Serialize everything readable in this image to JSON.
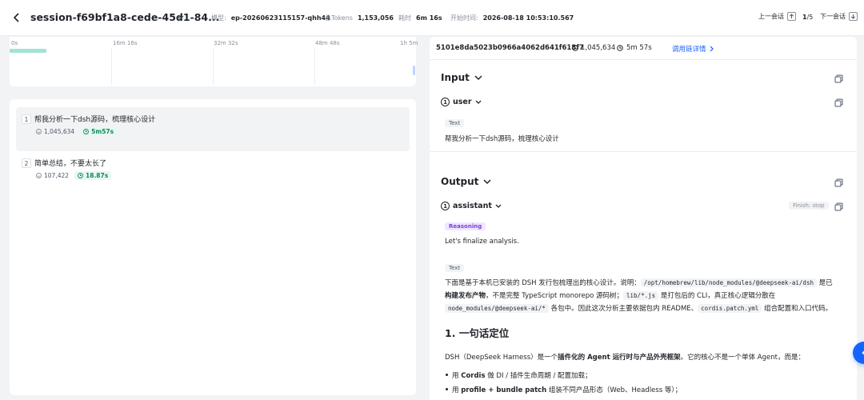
{
  "header": {
    "title": "session-f69bf1a8-cede-45d1-84...",
    "model_label": "模型:",
    "model_value": "ep-20260623115157-qhh44",
    "tokens_label": "总Tokens",
    "tokens_value": "1,153,056",
    "duration_label": "耗时",
    "duration_value": "6m 16s",
    "start_label": "开始时间:",
    "start_value": "2026-08-18 10:53:10.567",
    "prev_label": "上一会话",
    "page_current": "1",
    "page_total": "/5",
    "next_label": "下一会话"
  },
  "timeline": {
    "ticks": [
      "0s",
      "16m 16s",
      "32m 32s",
      "48m 48s",
      "1h 5m"
    ],
    "bar_fraction": 0.09
  },
  "conversations": [
    {
      "index": "1",
      "question": "帮我分析一下dsh源码，梳理核心设计",
      "tokens": "1,045,634",
      "duration": "5m57s"
    },
    {
      "index": "2",
      "question": "简单总结，不要太长了",
      "tokens": "107,422",
      "duration": "18.87s"
    }
  ],
  "detail": {
    "id": "5101e8da5023b0966a4062d641f618f7",
    "tokens": "1,045,634",
    "duration": "5m 57s",
    "link_label": "调用链详情",
    "input_title": "Input",
    "input_role_index": "1",
    "input_role": "user",
    "input_chip": "Text",
    "input_text": "帮我分析一下dsh源码，梳理核心设计",
    "output_title": "Output",
    "output_role_index": "1",
    "output_role": "assistant",
    "finish": "Finish: stop",
    "reasoning_chip": "Reasoning",
    "reasoning_text": "Let's finalize analysis.",
    "text_chip": "Text",
    "para": {
      "p1": "下面是基于本机已安装的 DSH 发行包梳理出的核心设计。说明：",
      "code1": "/opt/homebrew/lib/node_modules/@deepseek-ai/dsh",
      "p2": " 是已",
      "b1": "构建发布产物",
      "p3": "，不是完整 TypeScript monorepo 源码树；",
      "code2": "lib/*.js",
      "p4": " 是打包后的 CLI，真正核心逻辑分散在",
      "code3": "node_modules/@deepseek-ai/*",
      "p5": " 各包中。因此这次分析主要依据包内 README、",
      "code4": "cordis.patch.yml",
      "p6": " 组合配置和入口代码。"
    },
    "heading1": "1. 一句话定位",
    "summary": {
      "s1": "DSH（DeepSeek Harness）是一个",
      "b1": "插件化的 Agent 运行时与产品外壳框架",
      "s2": "。它的核心不是一个单体 Agent，而是："
    },
    "bullet1": {
      "pre": "用 ",
      "bold": "Cordis",
      "post": " 做 DI / 插件生命周期 / 配置加载；"
    },
    "bullet2": {
      "pre": "用 ",
      "bold": "profile + bundle patch",
      "post": " 组装不同产品形态（Web、Headless 等）；"
    }
  },
  "colors": {
    "accent": "#1664ff",
    "success": "#0f8a5f",
    "reasoning": "#7a3ee0"
  }
}
